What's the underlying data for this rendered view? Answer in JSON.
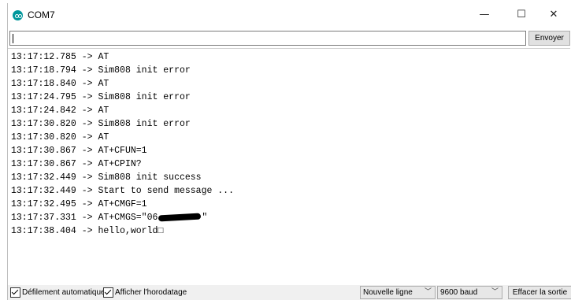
{
  "window": {
    "title": "COM7",
    "icon": "arduino-icon",
    "controls": {
      "minimize": "—",
      "maximize": "☐",
      "close": "✕"
    }
  },
  "input": {
    "value": "",
    "send_label": "Envoyer"
  },
  "output": {
    "lines": [
      {
        "time": "13:17:12.785",
        "arrow": "->",
        "text": "AT"
      },
      {
        "time": "13:17:18.794",
        "arrow": "->",
        "text": "Sim808 init error"
      },
      {
        "time": "13:17:18.840",
        "arrow": "->",
        "text": "AT"
      },
      {
        "time": "13:17:24.795",
        "arrow": "->",
        "text": "Sim808 init error"
      },
      {
        "time": "13:17:24.842",
        "arrow": "->",
        "text": "AT"
      },
      {
        "time": "13:17:30.820",
        "arrow": "->",
        "text": "Sim808 init error"
      },
      {
        "time": "13:17:30.820",
        "arrow": "->",
        "text": "AT"
      },
      {
        "time": "13:17:30.867",
        "arrow": "->",
        "text": "AT+CFUN=1"
      },
      {
        "time": "13:17:30.867",
        "arrow": "->",
        "text": "AT+CPIN?"
      },
      {
        "time": "13:17:32.449",
        "arrow": "->",
        "text": "Sim808 init success"
      },
      {
        "time": "13:17:32.449",
        "arrow": "->",
        "text": "Start to send message ..."
      },
      {
        "time": "13:17:32.495",
        "arrow": "->",
        "text": "AT+CMGF=1"
      },
      {
        "time": "13:17:37.331",
        "arrow": "->",
        "text_before": "AT+CMGS=\"06",
        "text_after": "\"",
        "redacted": true
      },
      {
        "time": "13:17:38.404",
        "arrow": "->",
        "text": "hello,world□"
      }
    ]
  },
  "statusbar": {
    "autoscroll": {
      "label": "Défilement automatique",
      "checked": true
    },
    "timestamp": {
      "label": "Afficher l'horodatage",
      "checked": true
    },
    "line_ending": "Nouvelle ligne",
    "baud_rate": "9600 baud",
    "clear_label": "Effacer la sortie"
  }
}
